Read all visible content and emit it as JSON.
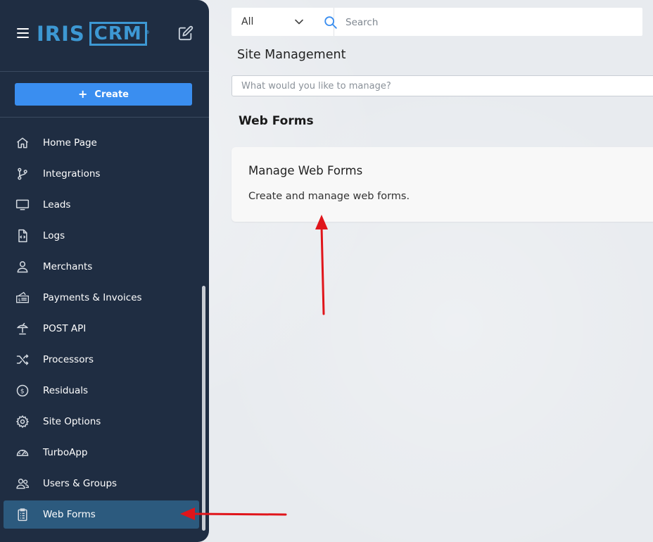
{
  "app": {
    "logo_text_1": "IRIS",
    "logo_text_2": "CRM",
    "logo_reg": "®",
    "create_label": "Create"
  },
  "sidebar": {
    "items": [
      {
        "label": "Home Page",
        "icon": "home-icon"
      },
      {
        "label": "Integrations",
        "icon": "branch-icon"
      },
      {
        "label": "Leads",
        "icon": "monitor-icon"
      },
      {
        "label": "Logs",
        "icon": "code-file-icon"
      },
      {
        "label": "Merchants",
        "icon": "user-icon"
      },
      {
        "label": "Payments & Invoices",
        "icon": "invoice-icon"
      },
      {
        "label": "POST API",
        "icon": "satellite-dish-icon"
      },
      {
        "label": "Processors",
        "icon": "shuffle-icon"
      },
      {
        "label": "Residuals",
        "icon": "dollar-circle-icon"
      },
      {
        "label": "Site Options",
        "icon": "gear-icon"
      },
      {
        "label": "TurboApp",
        "icon": "speedometer-icon"
      },
      {
        "label": "Users & Groups",
        "icon": "users-icon"
      },
      {
        "label": "Web Forms",
        "icon": "clipboard-icon",
        "active": true
      }
    ]
  },
  "search": {
    "filter_value": "All",
    "placeholder": "Search"
  },
  "main": {
    "page_title": "Site Management",
    "manage_placeholder": "What would you like to manage?",
    "section_title": "Web Forms",
    "card": {
      "title": "Manage Web Forms",
      "description": "Create and manage web forms."
    }
  },
  "colors": {
    "sidebar_bg": "#1f2d42",
    "active_item_bg": "#2c5a7e",
    "create_button": "#3a8ef0",
    "logo": "#3d98d3",
    "annotation_arrow": "#e0151b"
  }
}
